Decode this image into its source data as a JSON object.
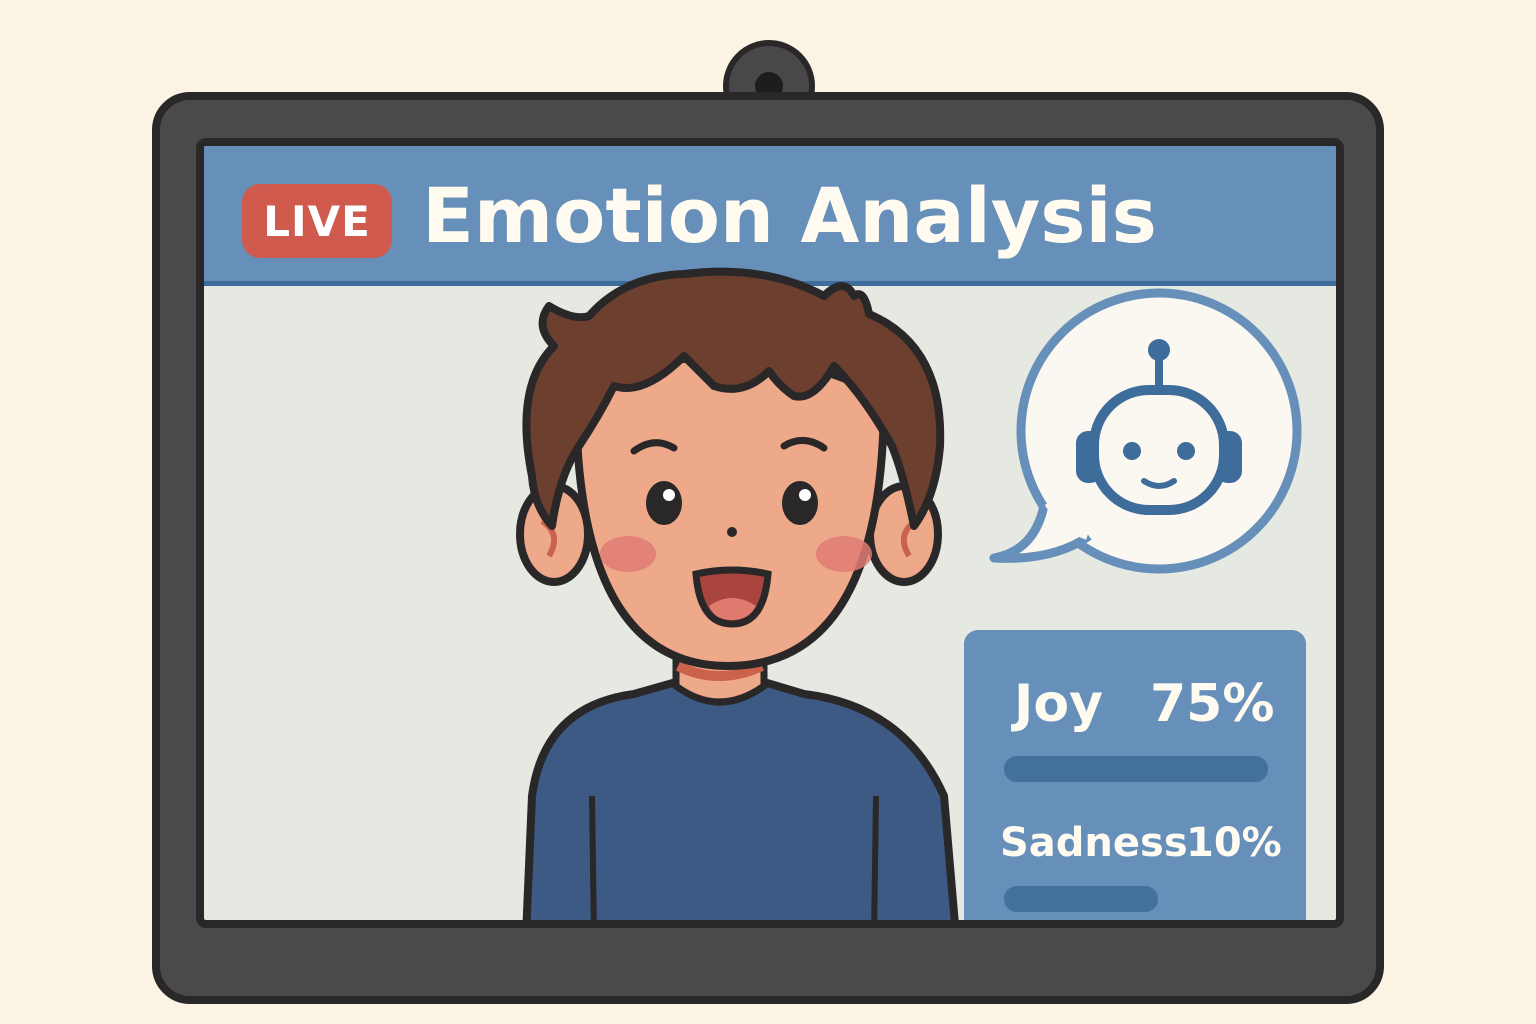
{
  "header": {
    "live_label": "LIVE",
    "title": "Emotion Analysis"
  },
  "assistant": {
    "icon": "robot-icon"
  },
  "emotions": [
    {
      "name": "Joy",
      "percent_label": "75%",
      "value": 0.75
    },
    {
      "name": "Sadness",
      "percent_label": "10%",
      "value": 0.1
    }
  ],
  "colors": {
    "live": "#cf5a4d",
    "header": "#6690b9",
    "panel": "#6690b9",
    "shirt": "#3c5a83"
  }
}
